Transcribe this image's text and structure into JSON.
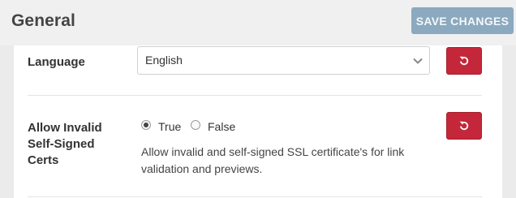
{
  "header": {
    "title": "General",
    "save_label": "SAVE CHANGES"
  },
  "settings": [
    {
      "label": "Language",
      "type": "select",
      "value": "English",
      "reset_icon": "reset-icon"
    },
    {
      "label_lines": [
        "Allow Invalid",
        "Self-Signed",
        "Certs"
      ],
      "type": "radio",
      "options": [
        {
          "label": "True",
          "checked": true
        },
        {
          "label": "False",
          "checked": false
        }
      ],
      "help": "Allow invalid and self-signed SSL certificate's for link validation and previews.",
      "reset_icon": "reset-icon"
    }
  ],
  "colors": {
    "accent_primary": "#8ba9bf",
    "danger": "#c4273a"
  }
}
